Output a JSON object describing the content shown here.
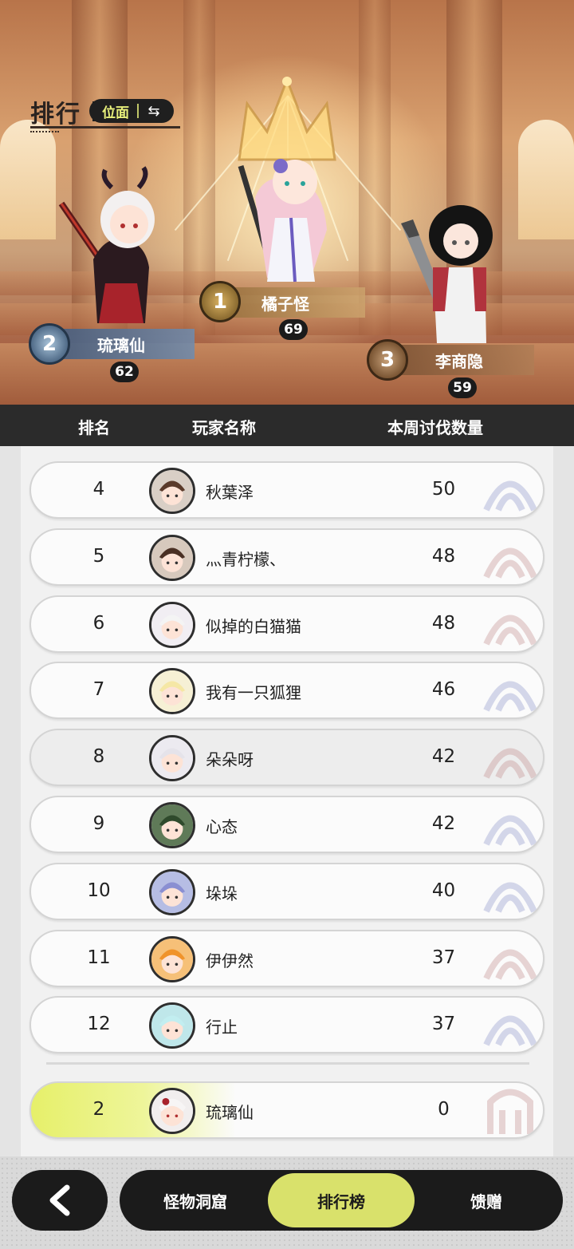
{
  "header": {
    "title": "排行",
    "plane_label": "位面",
    "swap_icon": "swap-arrows-icon"
  },
  "podium": [
    {
      "rank": "1",
      "name": "橘子怪",
      "score": "69"
    },
    {
      "rank": "2",
      "name": "琉璃仙",
      "score": "62"
    },
    {
      "rank": "3",
      "name": "李商隐",
      "score": "59"
    }
  ],
  "table": {
    "headers": {
      "rank": "排名",
      "player": "玩家名称",
      "count": "本周讨伐数量"
    },
    "rows": [
      {
        "rank": "4",
        "name": "秋葉泽",
        "count": "50"
      },
      {
        "rank": "5",
        "name": "灬青柠檬、",
        "count": "48"
      },
      {
        "rank": "6",
        "name": "似掉的白猫猫",
        "count": "48"
      },
      {
        "rank": "7",
        "name": "我有一只狐狸",
        "count": "46"
      },
      {
        "rank": "8",
        "name": "朵朵呀",
        "count": "42"
      },
      {
        "rank": "9",
        "name": "心态",
        "count": "42"
      },
      {
        "rank": "10",
        "name": "垛垛",
        "count": "40"
      },
      {
        "rank": "11",
        "name": "伊伊然",
        "count": "37"
      },
      {
        "rank": "12",
        "name": "行止",
        "count": "37"
      }
    ],
    "self_row": {
      "rank": "2",
      "name": "琉璃仙",
      "count": "0"
    }
  },
  "nav": {
    "back_icon": "chevron-left-icon",
    "tabs": [
      {
        "label": "怪物洞窟"
      },
      {
        "label": "排行榜"
      },
      {
        "label": "馈赠"
      }
    ],
    "active_tab": "排行榜"
  },
  "colors": {
    "accent": "#d9e16b",
    "dark": "#1b1b1b",
    "plane_text": "#e8f07b"
  }
}
